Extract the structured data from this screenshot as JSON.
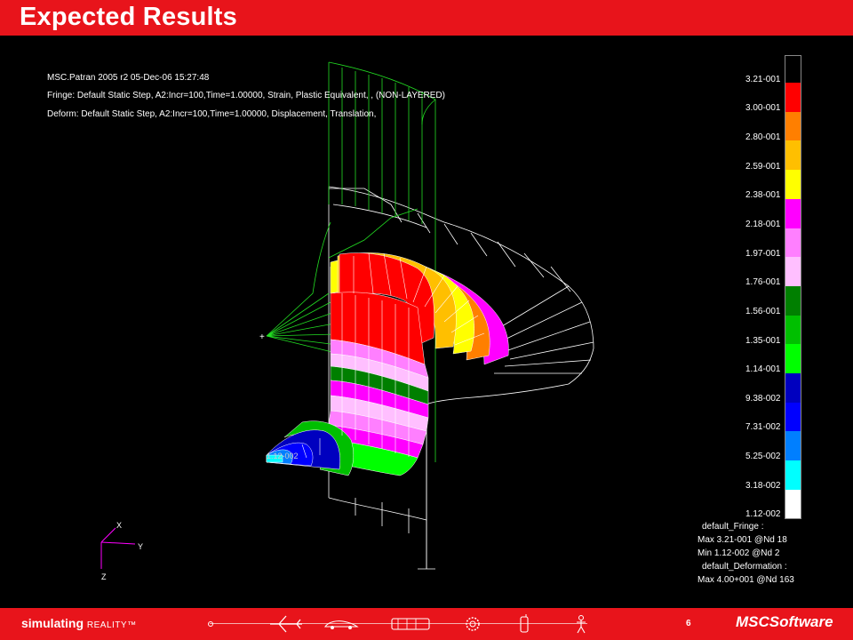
{
  "slide": {
    "title": "Expected Results",
    "page_number": "6"
  },
  "header_lines": [
    "MSC.Patran 2005 r2 05-Dec-06 15:27:48",
    "Fringe: Default Static Step, A2:Incr=100,Time=1.00000, Strain, Plastic Equivalent, , (NON-LAYERED)",
    "Deform: Default Static Step, A2:Incr=100,Time=1.00000, Displacement, Translation,"
  ],
  "legend": {
    "labels": [
      "3.21-001",
      "3.00-001",
      "2.80-001",
      "2.59-001",
      "2.38-001",
      "2.18-001",
      "1.97-001",
      "1.76-001",
      "1.56-001",
      "1.35-001",
      "1.14-001",
      "9.38-002",
      "7.31-002",
      "5.25-002",
      "3.18-002",
      "1.12-002"
    ],
    "colors": [
      "#ff0000",
      "#ff7f00",
      "#ffbf00",
      "#ffff00",
      "#ff00ff",
      "#ff7fff",
      "#ffbfff",
      "#007f00",
      "#00bf00",
      "#00ff00",
      "#0000bf",
      "#0000ff",
      "#007fff",
      "#00ffff",
      "#ffffff"
    ]
  },
  "summary": {
    "fringe_title": "default_Fringe :",
    "fringe_max": "Max 3.21-001 @Nd 18",
    "fringe_min": "Min 1.12-002 @Nd 2",
    "deform_title": "default_Deformation :",
    "deform_max": "Max 4.00+001 @Nd 163"
  },
  "axes": {
    "x": "X",
    "y": "Y",
    "z": "Z"
  },
  "model_labels": {
    "node_label": "1.12-002"
  },
  "footer": {
    "tagline_main": "simulating",
    "tagline_reality": "REALITY™",
    "brand": "MSC",
    "brand_suffix": "Software",
    "icons": [
      "dot-icon",
      "airplane-icon",
      "car-icon",
      "train-icon",
      "gear-icon",
      "phone-icon",
      "person-icon"
    ]
  }
}
